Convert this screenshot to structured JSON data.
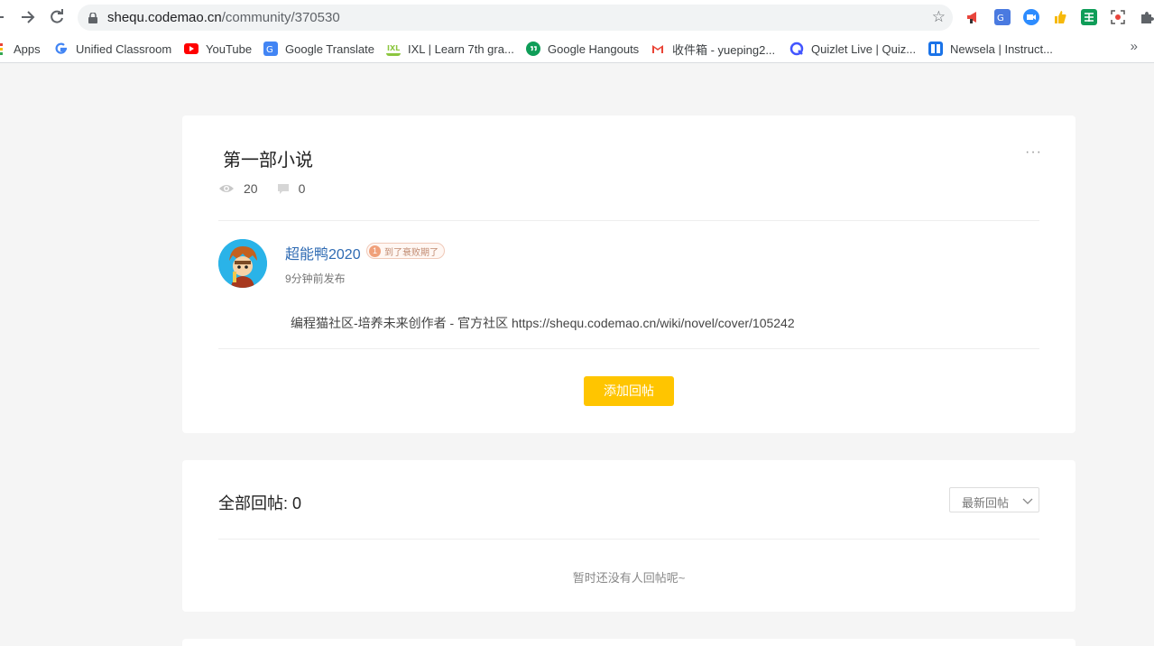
{
  "browser": {
    "url_host": "shequ.codemao.cn",
    "url_path": "/community/370530",
    "bookmarks": [
      {
        "label": "Apps",
        "icon": "apps-grid-icon",
        "color": "#ea4335"
      },
      {
        "label": "Unified Classroom",
        "icon": "google-g-icon",
        "color": "#4285f4"
      },
      {
        "label": "YouTube",
        "icon": "youtube-icon",
        "color": "#ff0000"
      },
      {
        "label": "Google Translate",
        "icon": "google-translate-icon",
        "color": "#4285f4"
      },
      {
        "label": "IXL | Learn 7th gra...",
        "icon": "ixl-icon",
        "color": "#8cc63f"
      },
      {
        "label": "Google Hangouts",
        "icon": "hangouts-icon",
        "color": "#0f9d58"
      },
      {
        "label": "收件箱 - yueping2...",
        "icon": "gmail-icon",
        "color": "#ea4335"
      },
      {
        "label": "Quizlet Live | Quiz...",
        "icon": "quizlet-icon",
        "color": "#4255ff"
      },
      {
        "label": "Newsela | Instruct...",
        "icon": "newsela-icon",
        "color": "#1a73e8"
      }
    ]
  },
  "post": {
    "title": "第一部小说",
    "views": "20",
    "comments": "0",
    "author": "超能鸭2020",
    "badge_level": "1",
    "badge_text": "到了衰败期了",
    "time": "9分钟前发布",
    "body": "编程猫社区-培养未来创作者 - 官方社区 https://shequ.codemao.cn/wiki/novel/cover/105242",
    "reply_button": "添加回帖"
  },
  "replies": {
    "title": "全部回帖: 0",
    "sort_label": "最新回帖",
    "empty_text": "暂时还没有人回帖呢~"
  },
  "colors": {
    "accent": "#ffc500",
    "author_link": "#2f6bb3",
    "page_bg": "#f5f5f5"
  }
}
